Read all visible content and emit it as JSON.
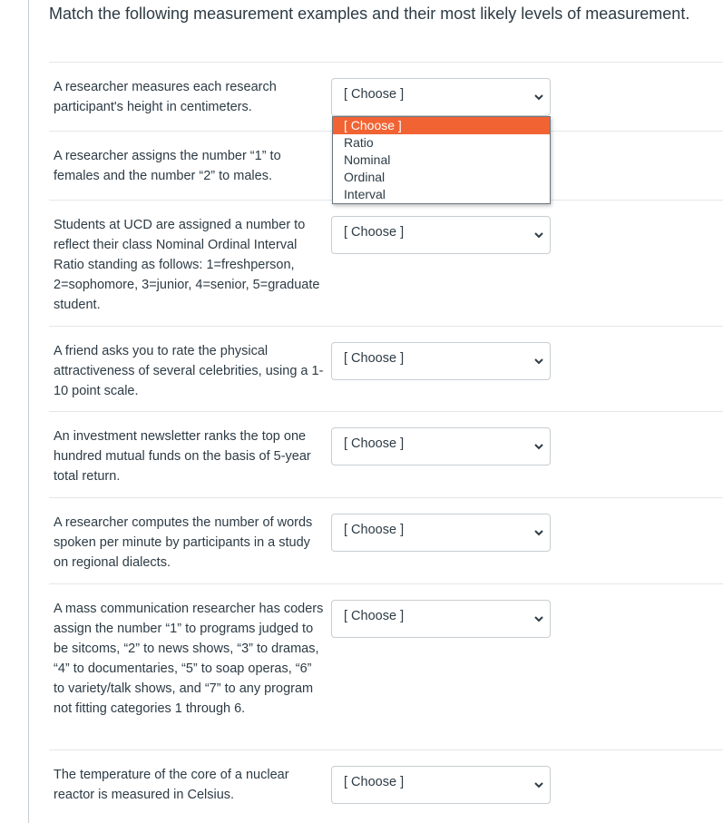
{
  "question": {
    "title": "Match the following measurement examples and their most likely levels of measurement."
  },
  "select_placeholder": "[ Choose ]",
  "rows": [
    {
      "prompt": "A researcher measures each research participant's height in centimeters.",
      "selected": ""
    },
    {
      "prompt": "A researcher assigns the number “1” to females and the number “2” to males.",
      "selected": ""
    },
    {
      "prompt": "Students at UCD are assigned a number to reflect their class Nominal Ordinal Interval Ratio standing as follows: 1=freshperson, 2=sophomore, 3=junior, 4=senior, 5=graduate student.",
      "selected": "[ Choose ]"
    },
    {
      "prompt": "A friend asks you to rate the physical attractiveness of several celebrities, using a 1-10 point scale.",
      "selected": "[ Choose ]"
    },
    {
      "prompt": "An investment newsletter ranks the top one hundred mutual funds on the basis of 5-year total return.",
      "selected": "[ Choose ]"
    },
    {
      "prompt": "A researcher computes the number of words spoken per minute by participants in a study on regional dialects.",
      "selected": "[ Choose ]"
    },
    {
      "prompt": "A mass communication researcher has coders assign the number “1” to programs judged to be sitcoms, “2” to news shows, “3” to dramas, “4” to documentaries, “5” to soap operas, “6” to variety/talk shows, and “7” to any program not fitting categories 1 through 6.",
      "selected": "[ Choose ]"
    },
    {
      "prompt": "The temperature of the core of a nuclear reactor is measured in Celsius.",
      "selected": "[ Choose ]"
    }
  ],
  "first_select_value": "[ Choose ]",
  "dropdown": {
    "options": [
      "[ Choose ]",
      "Ratio",
      "Nominal",
      "Ordinal",
      "Interval"
    ],
    "highlighted_index": 0,
    "highlight_color": "#f26333"
  },
  "icons": {
    "select_arrow": "chevron-down-icon"
  }
}
